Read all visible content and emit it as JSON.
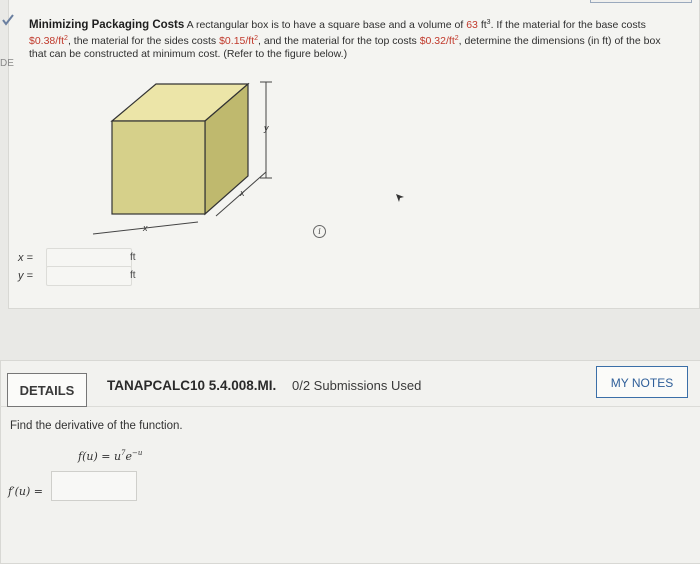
{
  "problem": {
    "title": "Minimizing Packaging Costs",
    "text_1": " A rectangular box is to have a square base and a volume of ",
    "volume": "63",
    "text_2": " ft",
    "text_3": ". If the material for the base costs ",
    "base_cost": "$0.38/ft",
    "text_4": ", the material for the sides costs ",
    "side_cost": "$0.15/ft",
    "text_5": ", and the material for the top costs ",
    "top_cost": "$0.32/ft",
    "text_6": ", determine the dimensions (in ft) of the box that can be constructed at minimum cost. (Refer to the figure below.)",
    "exp3": "3",
    "exp2": "2"
  },
  "left_margin_text": "DE",
  "figure": {
    "y_label": "y",
    "x_label_depth": "x",
    "x_label_width": "x",
    "box_color": "#d6d08a",
    "top_color": "#ece5a8",
    "side_color": "#bfb96e"
  },
  "answers": {
    "x_label": "x =",
    "y_label": "y =",
    "x_unit": "ft",
    "y_unit": "ft",
    "x_value": "",
    "y_value": ""
  },
  "info_icon": "i",
  "details_label": "DETAILS",
  "course_code": "TANAPCALC10 5.4.008.MI.",
  "submissions": "0/2 Submissions Used",
  "notes_label": "MY NOTES",
  "question": "Find the derivative of the function.",
  "function": {
    "lhs": "f(u) = u",
    "exp1": "7",
    "mid": "e",
    "exp2": "−u"
  },
  "derivative_label": "f′(u) =",
  "derivative_value": ""
}
